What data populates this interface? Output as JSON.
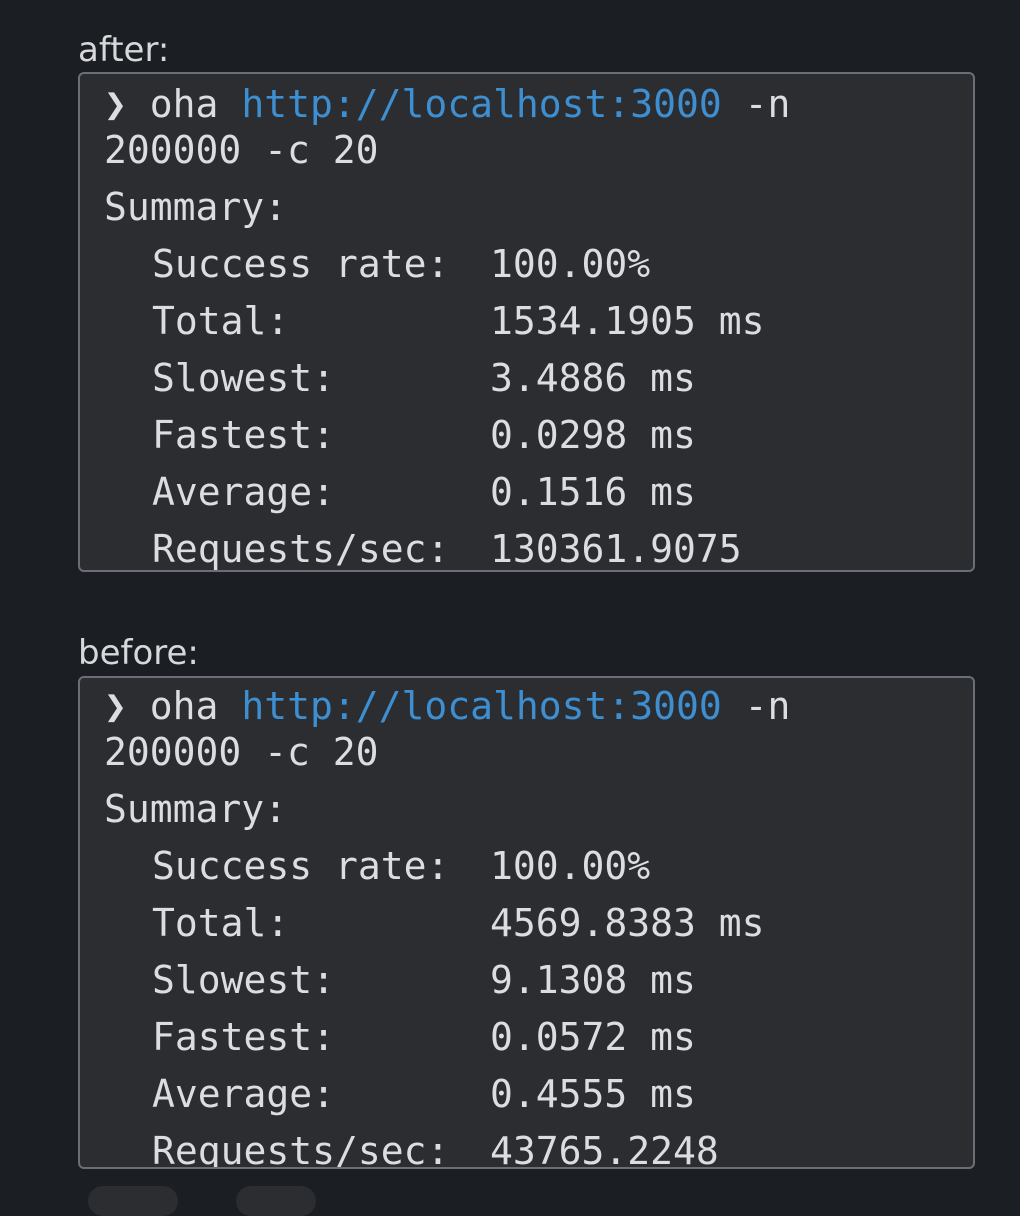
{
  "blocks": [
    {
      "label": "after:",
      "command": {
        "prompt_char": "❯",
        "program": "oha",
        "url": "http://localhost:3000",
        "flag_n": "-n",
        "line2": "200000 -c 20"
      },
      "summary_title": "Summary:",
      "rows": [
        {
          "label": "Success rate:",
          "value": "100.00%"
        },
        {
          "label": "Total:",
          "value": "1534.1905 ms"
        },
        {
          "label": "Slowest:",
          "value": "3.4886 ms"
        },
        {
          "label": "Fastest:",
          "value": "0.0298 ms"
        },
        {
          "label": "Average:",
          "value": "0.1516 ms"
        },
        {
          "label": "Requests/sec:",
          "value": "130361.9075"
        }
      ]
    },
    {
      "label": "before:",
      "command": {
        "prompt_char": "❯",
        "program": "oha",
        "url": "http://localhost:3000",
        "flag_n": "-n",
        "line2": "200000 -c 20"
      },
      "summary_title": "Summary:",
      "rows": [
        {
          "label": "Success rate:",
          "value": "100.00%"
        },
        {
          "label": "Total:",
          "value": "4569.8383 ms"
        },
        {
          "label": "Slowest:",
          "value": "9.1308 ms"
        },
        {
          "label": "Fastest:",
          "value": "0.0572 ms"
        },
        {
          "label": "Average:",
          "value": "0.4555 ms"
        },
        {
          "label": "Requests/sec:",
          "value": "43765.2248"
        }
      ]
    }
  ]
}
